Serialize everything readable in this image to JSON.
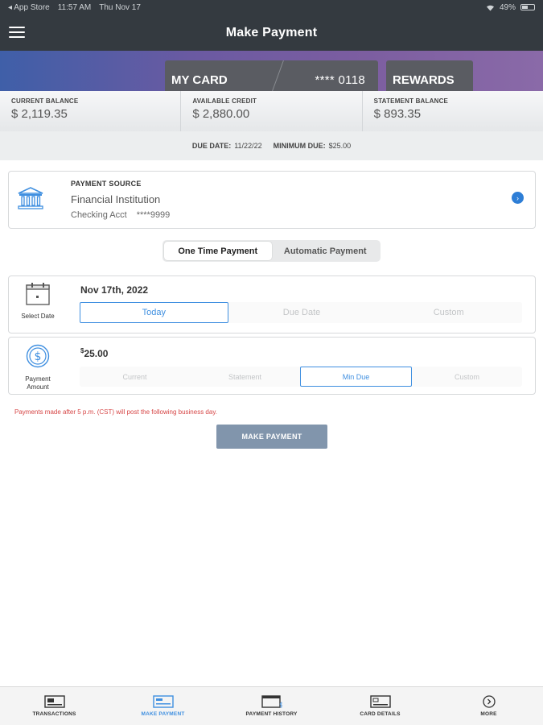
{
  "status_bar": {
    "left": [
      "◂ App Store",
      "11:57 AM",
      "Thu Nov 17"
    ],
    "battery": "49%"
  },
  "nav": {
    "title": "Make Payment"
  },
  "card_tabs": {
    "my_card": "MY CARD",
    "card_number": "**** 0118",
    "rewards": "REWARDS"
  },
  "balances": [
    {
      "label": "CURRENT BALANCE",
      "value": "$ 2,119.35"
    },
    {
      "label": "AVAILABLE CREDIT",
      "value": "$ 2,880.00"
    },
    {
      "label": "STATEMENT BALANCE",
      "value": "$ 893.35"
    }
  ],
  "due": {
    "due_label": "DUE DATE:",
    "due_value": "11/22/22",
    "min_label": "MINIMUM DUE:",
    "min_value": "$25.00"
  },
  "payment_source": {
    "label": "PAYMENT SOURCE",
    "institution": "Financial Institution",
    "account_type": "Checking Acct",
    "account_number": "****9999"
  },
  "payment_type": {
    "options": [
      "One Time Payment",
      "Automatic Payment"
    ],
    "selected": "One Time Payment"
  },
  "date_section": {
    "caption": "Select Date",
    "value": "Nov 17th, 2022",
    "options": [
      "Today",
      "Due Date",
      "Custom"
    ],
    "selected": "Today"
  },
  "amount_section": {
    "caption_line1": "Payment",
    "caption_line2": "Amount",
    "currency": "$",
    "value": "25.00",
    "options": [
      "Current",
      "Statement",
      "Min Due",
      "Custom"
    ],
    "selected": "Min Due"
  },
  "notice": "Payments made after 5 p.m. (CST) will post the following business day.",
  "make_payment_button": "MAKE PAYMENT",
  "tabbar": [
    {
      "label": "TRANSACTIONS",
      "icon": "card-icon",
      "active": false
    },
    {
      "label": "MAKE PAYMENT",
      "icon": "card-payment-icon",
      "active": true
    },
    {
      "label": "PAYMENT HISTORY",
      "icon": "calendar-dollar-icon",
      "active": false
    },
    {
      "label": "CARD DETAILS",
      "icon": "card-details-icon",
      "active": false
    },
    {
      "label": "MORE",
      "icon": "chevron-circle-icon",
      "active": false
    }
  ],
  "colors": {
    "nav_bg": "#343a40",
    "accent": "#3f8fe0",
    "button": "#8195ac",
    "notice": "#d64545"
  }
}
